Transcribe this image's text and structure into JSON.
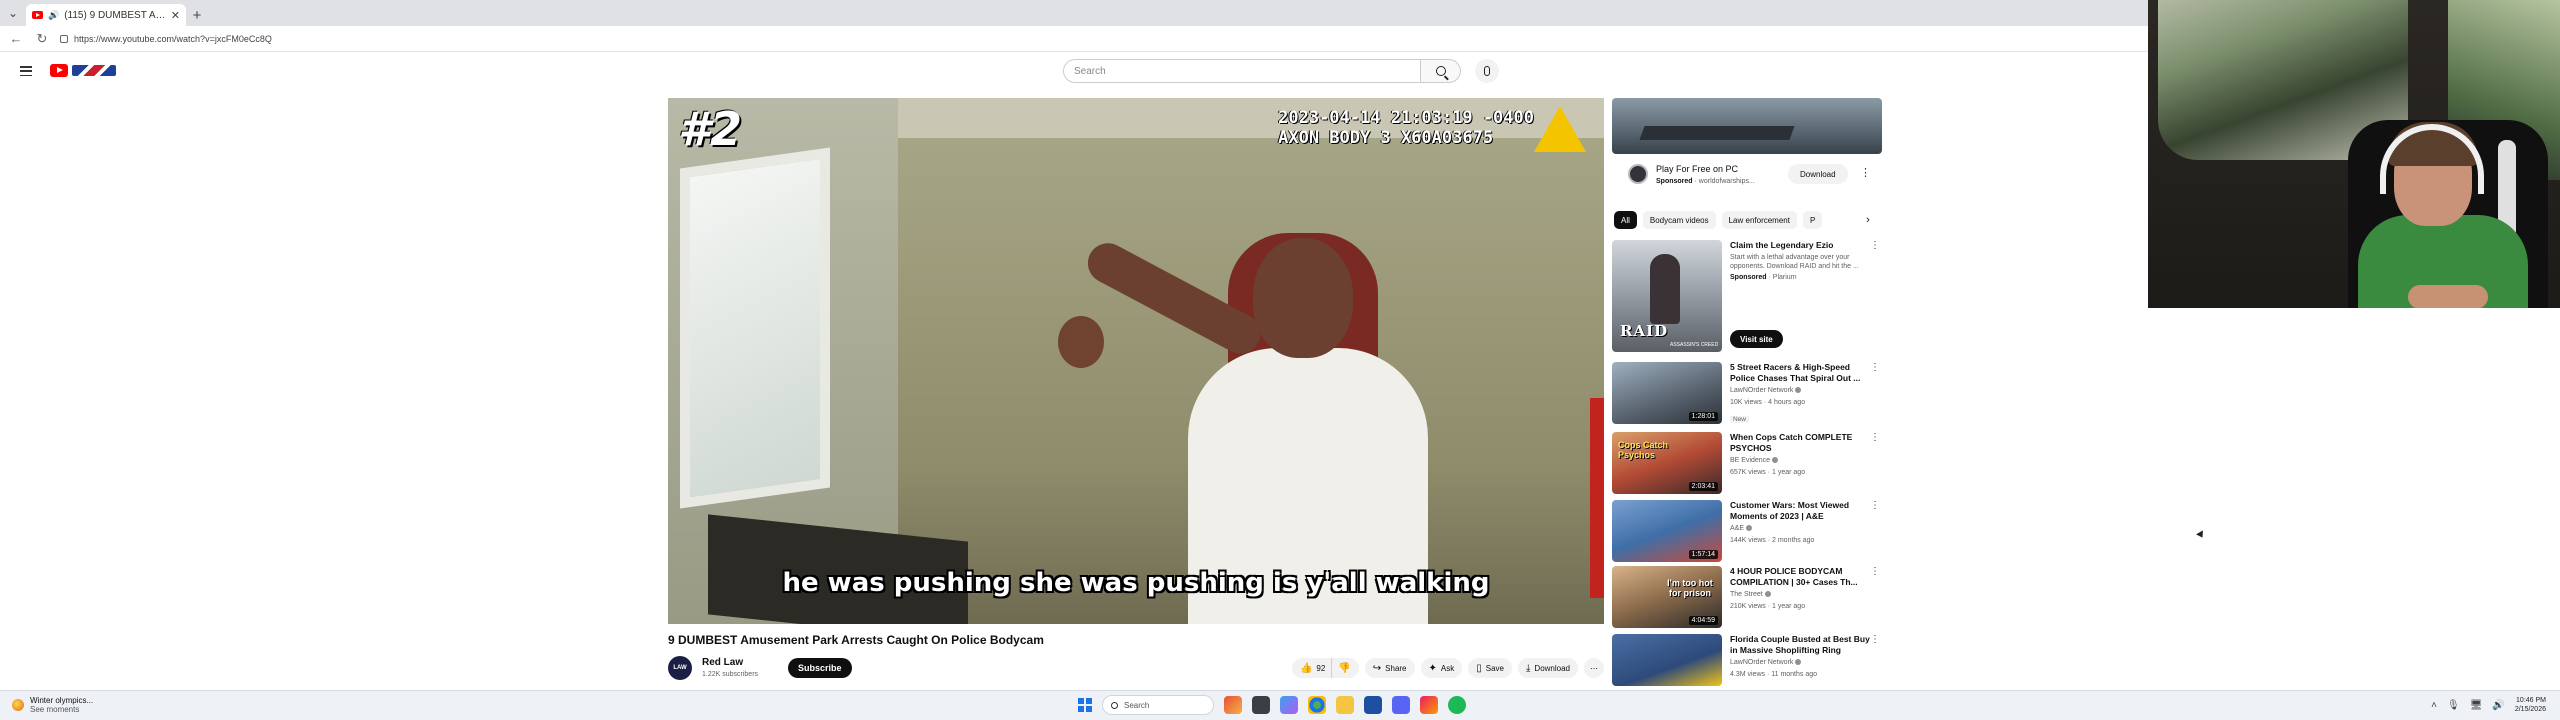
{
  "browser": {
    "tab_title": "(115) 9 DUMBEST Amusement...",
    "url": "https://www.youtube.com/watch?v=jxcFM0eCc8Q"
  },
  "youtube_header": {
    "search_placeholder": "Search"
  },
  "video": {
    "overlay_rank": "#2",
    "overlay_timestamp": "2023-04-14 21:03:19 -0400",
    "overlay_device": "AXON BODY 3 X60A03675",
    "overlay_caption": "he was pushing she was pushing is y'all walking",
    "title": "9 DUMBEST Amusement Park Arrests Caught On Police Bodycam",
    "channel_avatar_text": "LAW",
    "channel_name": "Red Law",
    "channel_subs": "1.22K subscribers",
    "subscribe_label": "Subscribe",
    "like_count": "92",
    "share_label": "Share",
    "ask_label": "Ask",
    "save_label": "Save",
    "download_label": "Download"
  },
  "sidebar": {
    "ad": {
      "title": "Play For Free on PC",
      "sponsored": "Sponsored",
      "domain": "· worldofwarships...",
      "button": "Download"
    },
    "chips": [
      "All",
      "Bodycam videos",
      "Law enforcement",
      "P"
    ],
    "sponsored_rec": {
      "title": "Claim the Legendary Ezio",
      "desc": "Start with a lethal advantage over your opponents. Download RAID and hit the ...",
      "sponsored": "Sponsored",
      "advertiser": "· Plarium",
      "thumb_text": "RAID",
      "thumb_subtext": "ASSASSIN'S CREED",
      "button": "Visit site"
    },
    "recommendations": [
      {
        "title": "5 Street Racers & High-Speed Police Chases That Spiral Out ...",
        "channel": "LawNOrder Network",
        "meta": "10K views · 4 hours ago",
        "badge": "New",
        "duration": "1:28:01"
      },
      {
        "title": "When Cops Catch COMPLETE PSYCHOS",
        "channel": "BE Evidence",
        "meta": "657K views · 1 year ago",
        "badge": "",
        "duration": "2:03:41"
      },
      {
        "title": "Customer Wars: Most Viewed Moments of 2023 | A&E",
        "channel": "A&E",
        "meta": "144K views · 2 months ago",
        "badge": "",
        "duration": "1:57:14"
      },
      {
        "title": "4 HOUR POLICE BODYCAM COMPILATION | 30+ Cases Th...",
        "channel": "The Street",
        "meta": "210K views · 1 year ago",
        "badge": "",
        "duration": "4:04:59"
      },
      {
        "title": "Florida Couple Busted at Best Buy in Massive Shoplifting Ring",
        "channel": "LawNOrder Network",
        "meta": "4.3M views · 11 months ago",
        "badge": "",
        "duration": ""
      }
    ]
  },
  "thumb_colors": [
    "#6a7b8c",
    "#c9604a",
    "#3f6fa8",
    "#b58a63",
    "#2e4a7a"
  ],
  "thumb_texts": [
    "",
    "Cops Catch Psychos",
    "",
    "I'm too hot for prison",
    ""
  ],
  "taskbar": {
    "weather_line1": "Winter olympics...",
    "weather_line2": "See moments",
    "search_label": "Search",
    "time": "10:46 PM",
    "date": "2/15/2026"
  },
  "colors": {
    "youtube_red": "#ff0000",
    "accent": "#1a73e8"
  }
}
